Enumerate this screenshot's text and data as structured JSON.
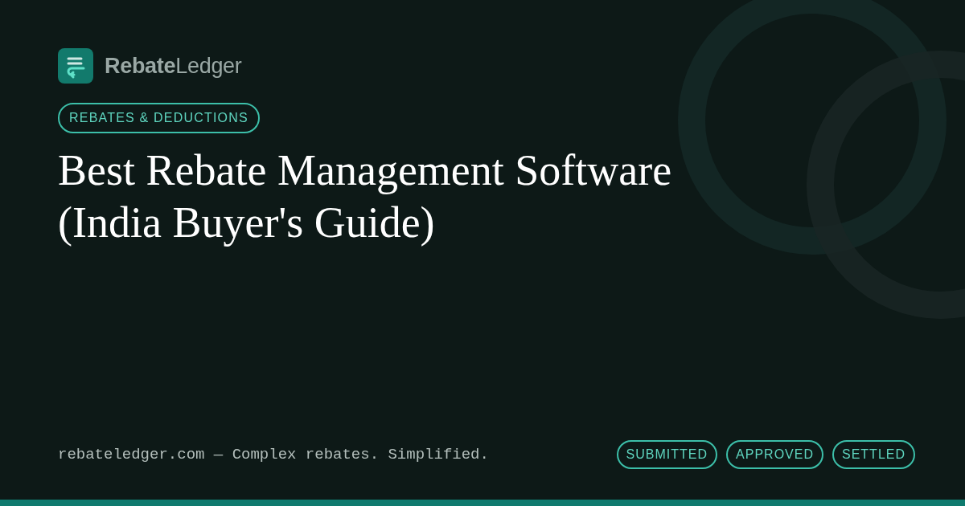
{
  "brand": {
    "name": "**Rebate**Ledger"
  },
  "category": "REBATES & DEDUCTIONS",
  "title_lines": [
    "Best Rebate Management Software",
    "(India Buyer's Guide)"
  ],
  "footer": {
    "tagline": "rebateledger.com — Complex rebates. Simplified.",
    "statuses": [
      "SUBMITTED",
      "APPROVED",
      "SETTLED"
    ]
  }
}
